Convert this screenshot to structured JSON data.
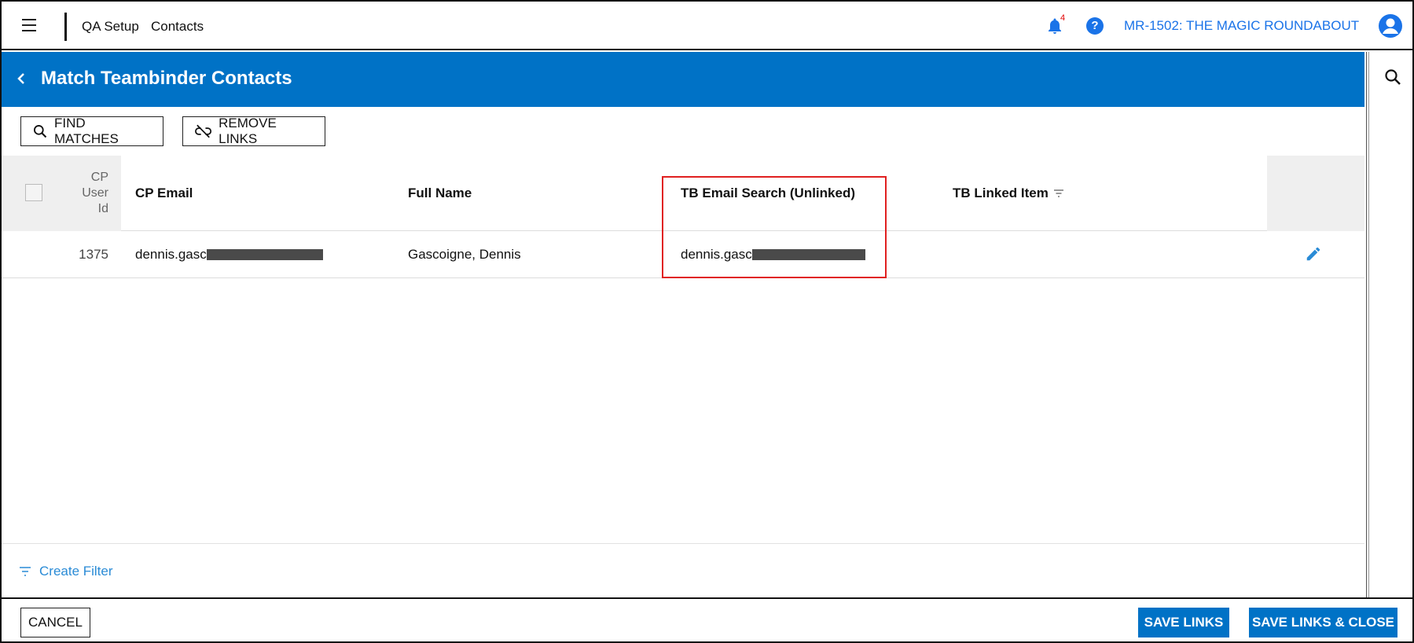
{
  "topbar": {
    "breadcrumb_1": "QA Setup",
    "breadcrumb_2": "Contacts",
    "notification_count": "4",
    "help_label": "?",
    "project": "MR-1502: THE MAGIC ROUNDABOUT"
  },
  "header": {
    "title": "Match Teambinder Contacts"
  },
  "toolbar": {
    "find_matches": "FIND MATCHES",
    "remove_links": "REMOVE LINKS"
  },
  "table": {
    "columns": {
      "cp_user_id": "CP User Id",
      "cp_email": "CP Email",
      "full_name": "Full Name",
      "tb_email_search": "TB Email Search (Unlinked)",
      "tb_linked_item": "TB Linked Item"
    },
    "rows": [
      {
        "cp_user_id": "1375",
        "cp_email_visible": "dennis.gasc",
        "full_name": "Gascoigne, Dennis",
        "tb_email_visible": "dennis.gasc",
        "tb_linked_item": ""
      }
    ]
  },
  "filter": {
    "create_label": "Create Filter"
  },
  "footer": {
    "cancel": "CANCEL",
    "save_links": "SAVE LINKS",
    "save_links_close": "SAVE LINKS & CLOSE"
  },
  "colors": {
    "primary": "#0072c6",
    "link": "#1a73e8",
    "highlight_border": "#e02020",
    "badge": "#e00000"
  },
  "icons": [
    "menu-icon",
    "bell-icon",
    "help-icon",
    "account-icon",
    "chevron-left-icon",
    "search-icon",
    "link-off-icon",
    "sort-icon",
    "edit-icon",
    "filter-icon"
  ]
}
